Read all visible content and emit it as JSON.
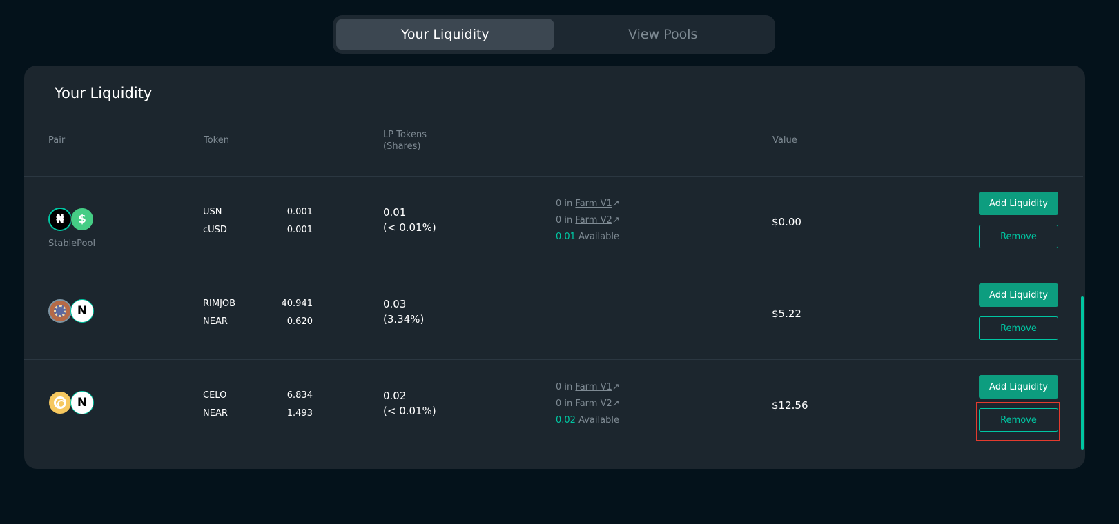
{
  "tabs": [
    {
      "label": "Your Liquidity",
      "active": true
    },
    {
      "label": "View Pools",
      "active": false
    }
  ],
  "card": {
    "title": "Your Liquidity",
    "headers": {
      "pair": "Pair",
      "token": "Token",
      "lp_line1": "LP Tokens",
      "lp_line2": "(Shares)",
      "value": "Value"
    },
    "rows": [
      {
        "icons": [
          "usn-icon",
          "cusd-icon"
        ],
        "pool_label": "StablePool",
        "tokens": [
          {
            "symbol": "USN",
            "amount": "0.001"
          },
          {
            "symbol": "cUSD",
            "amount": "0.001"
          }
        ],
        "lp_amount": "0.01",
        "lp_share": "(< 0.01%)",
        "farms": {
          "v1_prefix": "0 in",
          "v1_link": "Farm  V1",
          "v2_prefix": "0 in",
          "v2_link": "Farm  V2",
          "available_amount": "0.01",
          "available_label": "Available"
        },
        "value": "$0.00",
        "add_label": "Add Liquidity",
        "remove_label": "Remove"
      },
      {
        "icons": [
          "rimjob-icon",
          "near-icon"
        ],
        "pool_label": "",
        "tokens": [
          {
            "symbol": "RIMJOB",
            "amount": "40.941"
          },
          {
            "symbol": "NEAR",
            "amount": "0.620"
          }
        ],
        "lp_amount": "0.03",
        "lp_share": "(3.34%)",
        "value": "$5.22",
        "add_label": "Add Liquidity",
        "remove_label": "Remove"
      },
      {
        "icons": [
          "celo-icon",
          "near-icon"
        ],
        "pool_label": "",
        "tokens": [
          {
            "symbol": "CELO",
            "amount": "6.834"
          },
          {
            "symbol": "NEAR",
            "amount": "1.493"
          }
        ],
        "lp_amount": "0.02",
        "lp_share": "(< 0.01%)",
        "farms": {
          "v1_prefix": "0 in",
          "v1_link": "Farm  V1",
          "v2_prefix": "0 in",
          "v2_link": "Farm  V2",
          "available_amount": "0.02",
          "available_label": "Available"
        },
        "value": "$12.56",
        "add_label": "Add Liquidity",
        "remove_label": "Remove"
      }
    ]
  },
  "colors": {
    "accent": "#00c6a2",
    "highlight": "#e33b2e",
    "background": "#04121b",
    "card": "#1c262e"
  }
}
